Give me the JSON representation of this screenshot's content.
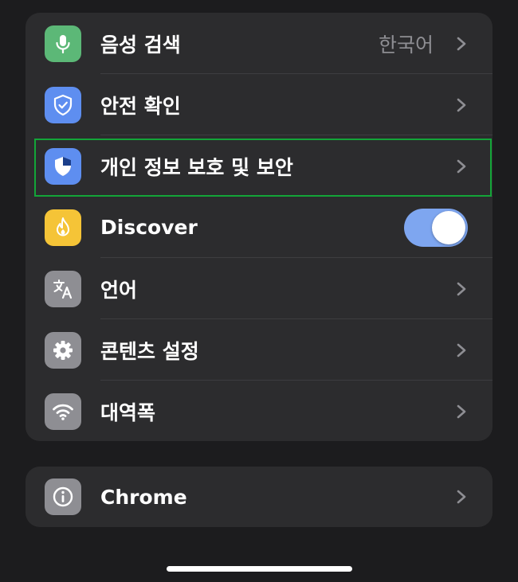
{
  "settings": {
    "voice_search": {
      "label": "음성 검색",
      "value": "한국어",
      "icon": "mic-icon",
      "icon_color": "#5cb877"
    },
    "safety_check": {
      "label": "안전 확인",
      "icon": "shield-check-icon",
      "icon_color": "#5e8ef0"
    },
    "privacy_security": {
      "label": "개인 정보 보호 및 보안",
      "icon": "shield-icon",
      "icon_color": "#5e8ef0"
    },
    "discover": {
      "label": "Discover",
      "icon": "flame-icon",
      "icon_color": "#f5c437",
      "toggle_on": true
    },
    "language": {
      "label": "언어",
      "icon": "translate-icon",
      "icon_color": "#8e8e93"
    },
    "content_settings": {
      "label": "콘텐츠 설정",
      "icon": "gear-icon",
      "icon_color": "#8e8e93"
    },
    "bandwidth": {
      "label": "대역폭",
      "icon": "wifi-icon",
      "icon_color": "#8e8e93"
    }
  },
  "about": {
    "chrome": {
      "label": "Chrome",
      "icon": "info-icon",
      "icon_color": "#8e8e93"
    }
  },
  "colors": {
    "background": "#1c1c1e",
    "group": "#2c2c2e",
    "highlight": "#13a538",
    "toggle_on": "#7ea6f0"
  }
}
